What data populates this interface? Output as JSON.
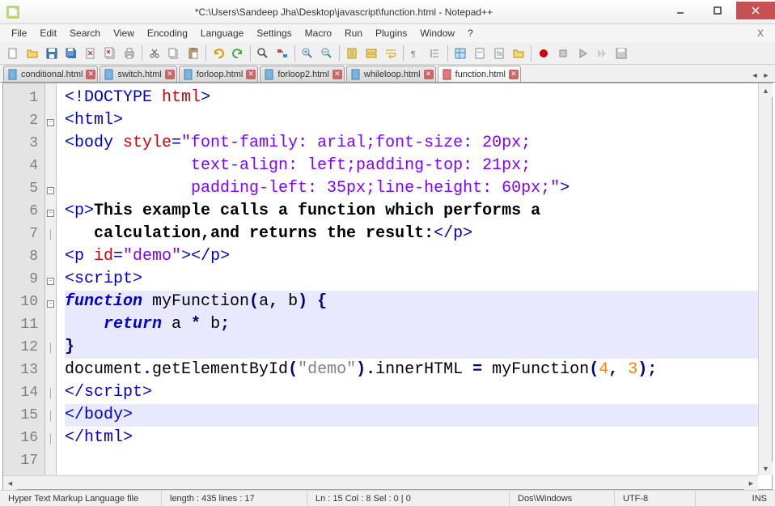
{
  "window": {
    "title": "*C:\\Users\\Sandeep Jha\\Desktop\\javascript\\function.html - Notepad++"
  },
  "menu": {
    "items": [
      "File",
      "Edit",
      "Search",
      "View",
      "Encoding",
      "Language",
      "Settings",
      "Macro",
      "Run",
      "Plugins",
      "Window",
      "?"
    ]
  },
  "tabs": {
    "items": [
      {
        "name": "conditional.html",
        "active": false,
        "dirty": false
      },
      {
        "name": "switch.html",
        "active": false,
        "dirty": false
      },
      {
        "name": "forloop.html",
        "active": false,
        "dirty": false
      },
      {
        "name": "forloop2.html",
        "active": false,
        "dirty": false
      },
      {
        "name": "whileloop.html",
        "active": false,
        "dirty": false
      },
      {
        "name": "function.html",
        "active": true,
        "dirty": true
      }
    ]
  },
  "code": {
    "lines": [
      {
        "n": 1,
        "fold": "",
        "segments": [
          {
            "t": "<!",
            "c": "tag"
          },
          {
            "t": "DOCTYPE",
            "c": "tag"
          },
          {
            "t": " ",
            "c": ""
          },
          {
            "t": "html",
            "c": "attr"
          },
          {
            "t": ">",
            "c": "tag"
          }
        ]
      },
      {
        "n": 2,
        "fold": "minus",
        "segments": [
          {
            "t": "<html>",
            "c": "tag"
          }
        ]
      },
      {
        "n": 3,
        "fold": "",
        "segments": [
          {
            "t": "<body ",
            "c": "tag"
          },
          {
            "t": "style",
            "c": "attr"
          },
          {
            "t": "=",
            "c": "tag"
          },
          {
            "t": "\"font-family: arial;font-size: 20px;",
            "c": "str"
          }
        ]
      },
      {
        "n": 4,
        "fold": "",
        "segments": [
          {
            "t": "             text-align: left;padding-top: 21px;",
            "c": "str"
          }
        ]
      },
      {
        "n": 5,
        "fold": "minus",
        "segments": [
          {
            "t": "             padding-left: 35px;line-height: 60px;\"",
            "c": "str"
          },
          {
            "t": ">",
            "c": "tag"
          }
        ]
      },
      {
        "n": 6,
        "fold": "minus",
        "segments": [
          {
            "t": "<p>",
            "c": "tag"
          },
          {
            "t": "This example calls a function which performs a",
            "c": "txt"
          }
        ]
      },
      {
        "n": 7,
        "fold": "end",
        "segments": [
          {
            "t": "   calculation,and returns the result:",
            "c": "txt"
          },
          {
            "t": "</p>",
            "c": "tag"
          }
        ]
      },
      {
        "n": 8,
        "fold": "",
        "segments": [
          {
            "t": "<p ",
            "c": "tag"
          },
          {
            "t": "id",
            "c": "attr"
          },
          {
            "t": "=",
            "c": "tag"
          },
          {
            "t": "\"demo\"",
            "c": "str"
          },
          {
            "t": "></p>",
            "c": "tag"
          }
        ]
      },
      {
        "n": 9,
        "fold": "minus",
        "segments": [
          {
            "t": "<script>",
            "c": "tag"
          }
        ]
      },
      {
        "n": 10,
        "fold": "minus",
        "hl": true,
        "segments": [
          {
            "t": "function",
            "c": "kw"
          },
          {
            "t": " myFunction",
            "c": "fn"
          },
          {
            "t": "(",
            "c": "op"
          },
          {
            "t": "a",
            "c": "fn"
          },
          {
            "t": ",",
            "c": "op"
          },
          {
            "t": " b",
            "c": "fn"
          },
          {
            "t": ")",
            "c": "op"
          },
          {
            "t": " ",
            "c": ""
          },
          {
            "t": "{",
            "c": "op"
          }
        ]
      },
      {
        "n": 11,
        "fold": "",
        "hl": true,
        "segments": [
          {
            "t": "    ",
            "c": ""
          },
          {
            "t": "return",
            "c": "kw"
          },
          {
            "t": " a ",
            "c": "fn"
          },
          {
            "t": "*",
            "c": "op"
          },
          {
            "t": " b",
            "c": "fn"
          },
          {
            "t": ";",
            "c": "op"
          }
        ]
      },
      {
        "n": 12,
        "fold": "end",
        "hl": true,
        "segments": [
          {
            "t": "}",
            "c": "op"
          }
        ]
      },
      {
        "n": 13,
        "fold": "",
        "segments": [
          {
            "t": "document",
            "c": "fn"
          },
          {
            "t": ".",
            "c": "op"
          },
          {
            "t": "getElementById",
            "c": "fn"
          },
          {
            "t": "(",
            "c": "op"
          },
          {
            "t": "\"demo\"",
            "c": "gray"
          },
          {
            "t": ").",
            "c": "op"
          },
          {
            "t": "innerHTML ",
            "c": "fn"
          },
          {
            "t": "=",
            "c": "op"
          },
          {
            "t": " myFunction",
            "c": "fn"
          },
          {
            "t": "(",
            "c": "op"
          },
          {
            "t": "4",
            "c": "num"
          },
          {
            "t": ",",
            "c": "op"
          },
          {
            "t": " ",
            "c": ""
          },
          {
            "t": "3",
            "c": "num"
          },
          {
            "t": ");",
            "c": "op"
          }
        ]
      },
      {
        "n": 14,
        "fold": "end",
        "segments": [
          {
            "t": "</script>",
            "c": "tag"
          }
        ]
      },
      {
        "n": 15,
        "fold": "end",
        "hl": true,
        "segments": [
          {
            "t": "</body>",
            "c": "tag"
          }
        ]
      },
      {
        "n": 16,
        "fold": "end",
        "segments": [
          {
            "t": "</html>",
            "c": "tag"
          }
        ]
      },
      {
        "n": 17,
        "fold": "",
        "segments": []
      }
    ]
  },
  "status": {
    "filetype": "Hyper Text Markup Language file",
    "length": "length : 435    lines : 17",
    "position": "Ln : 15    Col : 8    Sel : 0 | 0",
    "eol": "Dos\\Windows",
    "encoding": "UTF-8",
    "mode": "INS"
  }
}
